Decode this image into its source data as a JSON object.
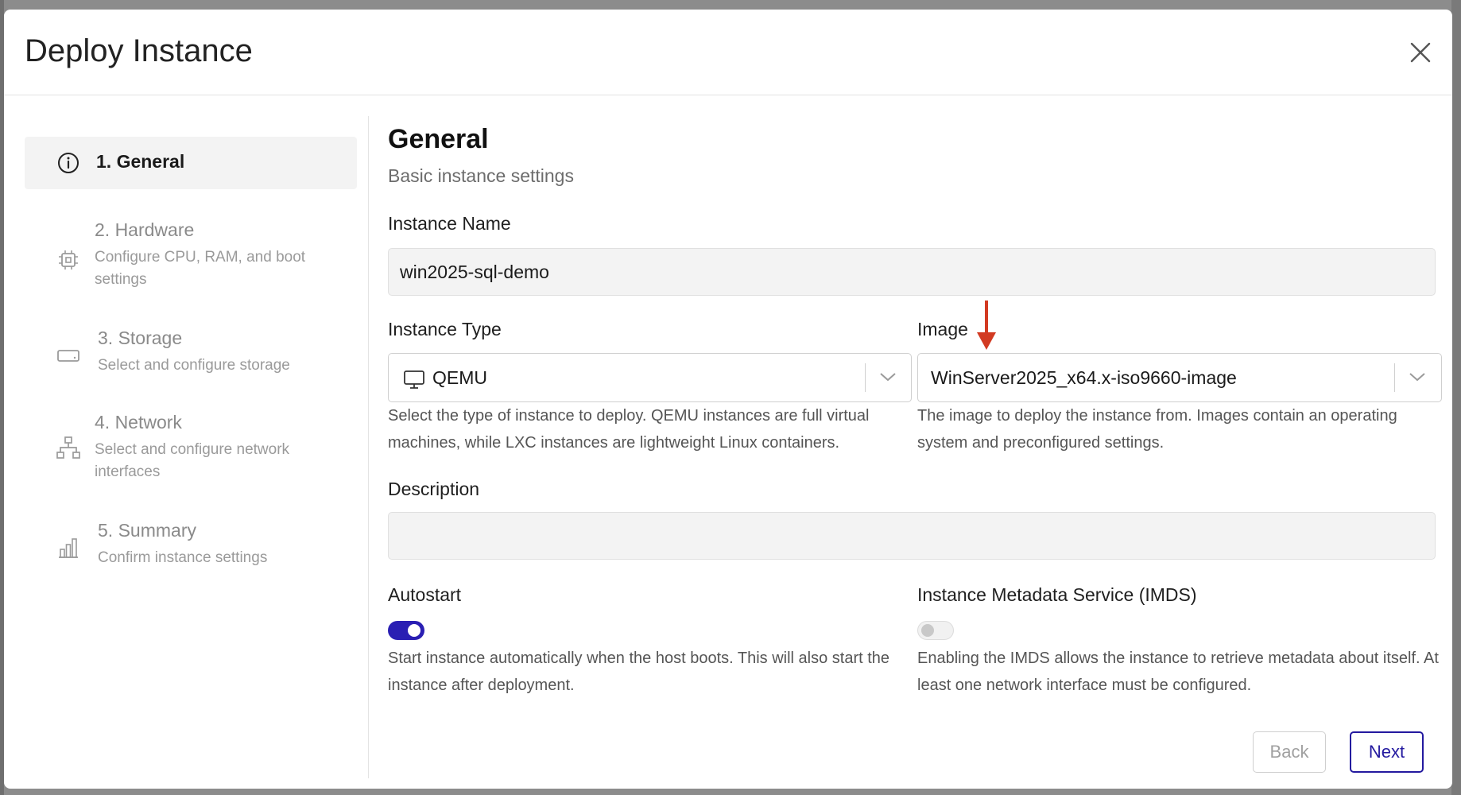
{
  "modal": {
    "title": "Deploy Instance"
  },
  "steps": [
    {
      "title": "1. General",
      "subtitle": "",
      "icon": "info-icon",
      "active": true
    },
    {
      "title": "2. Hardware",
      "subtitle": "Configure CPU, RAM, and boot settings",
      "icon": "chip-icon",
      "active": false
    },
    {
      "title": "3. Storage",
      "subtitle": "Select and configure storage",
      "icon": "drive-icon",
      "active": false
    },
    {
      "title": "4. Network",
      "subtitle": "Select and configure network interfaces",
      "icon": "network-icon",
      "active": false
    },
    {
      "title": "5. Summary",
      "subtitle": "Confirm instance settings",
      "icon": "bar-chart-icon",
      "active": false
    }
  ],
  "general": {
    "title": "General",
    "subtitle": "Basic instance settings",
    "instance_name": {
      "label": "Instance Name",
      "value": "win2025-sql-demo"
    },
    "instance_type": {
      "label": "Instance Type",
      "value": "QEMU",
      "icon": "monitor-icon",
      "help": "Select the type of instance to deploy. QEMU instances are full virtual machines, while LXC instances are lightweight Linux containers."
    },
    "image": {
      "label": "Image",
      "value": "WinServer2025_x64.x-iso9660-image",
      "help": "The image to deploy the instance from. Images contain an operating system and preconfigured settings."
    },
    "description": {
      "label": "Description",
      "value": ""
    },
    "autostart": {
      "label": "Autostart",
      "enabled": true,
      "help": "Start instance automatically when the host boots. This will also start the instance after deployment."
    },
    "imds": {
      "label": "Instance Metadata Service (IMDS)",
      "enabled": false,
      "help": "Enabling the IMDS allows the instance to retrieve metadata about itself. At least one network interface must be configured."
    }
  },
  "footer": {
    "back_label": "Back",
    "next_label": "Next"
  },
  "colors": {
    "accent": "#23199f",
    "annotation_arrow": "#d23a22"
  }
}
